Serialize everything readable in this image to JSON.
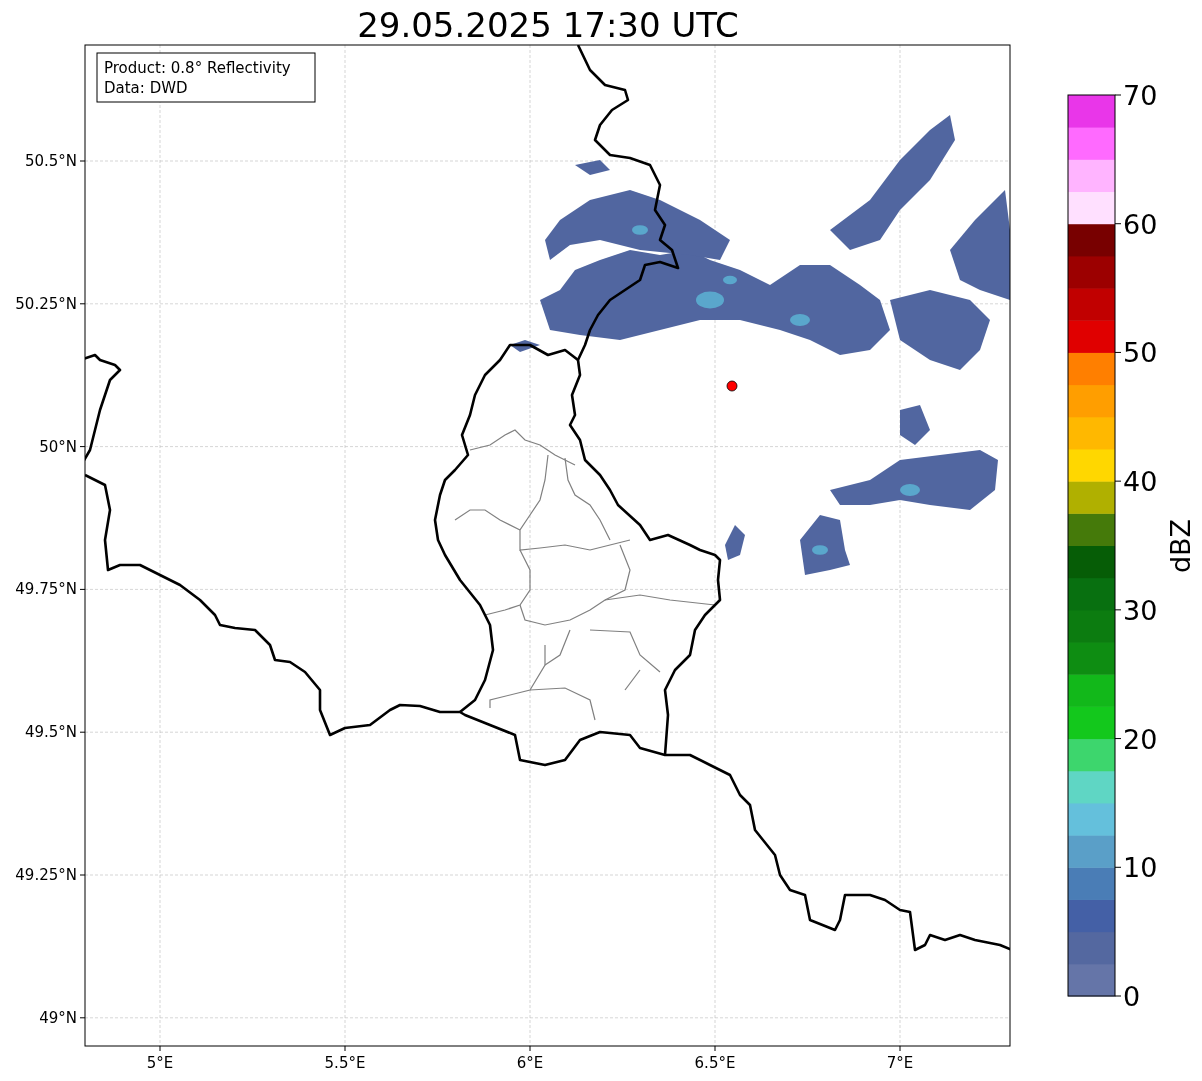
{
  "title": "29.05.2025 17:30 UTC",
  "info_box": {
    "lines": [
      "Product: 0.8° Reflectivity",
      "Data: DWD"
    ]
  },
  "map": {
    "y_tick_labels": [
      "50.5°N",
      "50.25°N",
      "50°N",
      "49.75°N",
      "49.5°N",
      "49.25°N",
      "49°N"
    ],
    "x_tick_labels": [
      "5°E",
      "5.5°E",
      "6°E",
      "6.5°E",
      "7°E"
    ]
  },
  "colorbar": {
    "label": "dBZ",
    "tick_labels": [
      "70",
      "60",
      "50",
      "40",
      "30",
      "20",
      "10",
      "0"
    ],
    "bins": [
      {
        "color": "#6575a8"
      },
      {
        "color": "#5468a0"
      },
      {
        "color": "#4460a6"
      },
      {
        "color": "#4a7db6"
      },
      {
        "color": "#5a9fc8"
      },
      {
        "color": "#64c0dc"
      },
      {
        "color": "#5fd6c4"
      },
      {
        "color": "#3dd66d"
      },
      {
        "color": "#13c81c"
      },
      {
        "color": "#12b81a"
      },
      {
        "color": "#0e8d12"
      },
      {
        "color": "#0c7c10"
      },
      {
        "color": "#087010"
      },
      {
        "color": "#065d06"
      },
      {
        "color": "#457a0a"
      },
      {
        "color": "#b0b000"
      },
      {
        "color": "#ffd700"
      },
      {
        "color": "#ffb800"
      },
      {
        "color": "#ff9e00"
      },
      {
        "color": "#ff7f00"
      },
      {
        "color": "#e00000"
      },
      {
        "color": "#c10000"
      },
      {
        "color": "#9c0000"
      },
      {
        "color": "#780000"
      },
      {
        "color": "#ffe0ff"
      },
      {
        "color": "#ffb4ff"
      },
      {
        "color": "#ff6aff"
      },
      {
        "color": "#e936e9"
      }
    ]
  }
}
